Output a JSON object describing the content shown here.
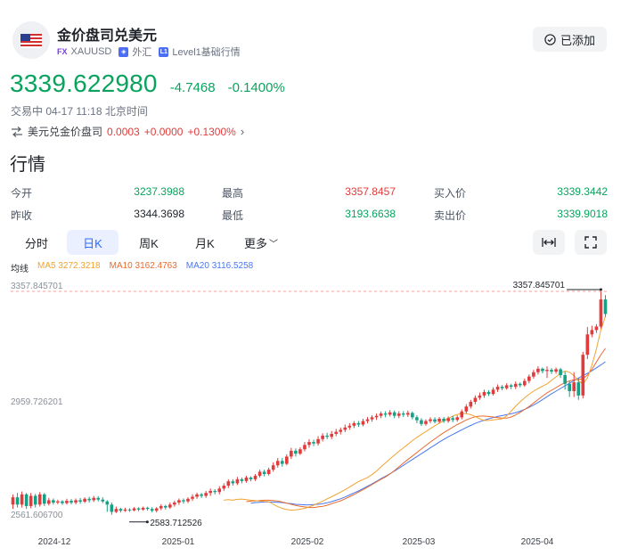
{
  "header": {
    "title": "金价盘司兑美元",
    "symbol_tag": "FX",
    "symbol": "XAUUSD",
    "market": "外汇",
    "level_tag": "L1",
    "level": "Level1基础行情",
    "added_label": "已添加"
  },
  "price": {
    "last": "3339.622980",
    "change": "-4.7468",
    "change_pct": "-0.1400%"
  },
  "status": "交易中 04-17 11:18 北京时间",
  "inverse": {
    "label": "美元兑金价盘司",
    "value": "0.0003",
    "change": "+0.0000",
    "change_pct": "+0.1300%"
  },
  "section_title": "行情",
  "quote": [
    [
      {
        "label": "今开",
        "value": "3237.3988",
        "color": "green"
      },
      {
        "label": "最高",
        "value": "3357.8457",
        "color": "red"
      },
      {
        "label": "买入价",
        "value": "3339.3442",
        "color": "green"
      }
    ],
    [
      {
        "label": "昨收",
        "value": "3344.3698",
        "color": "plain"
      },
      {
        "label": "最低",
        "value": "3193.6638",
        "color": "green"
      },
      {
        "label": "卖出价",
        "value": "3339.9018",
        "color": "green"
      }
    ]
  ],
  "tabs": [
    "分时",
    "日K",
    "周K",
    "月K",
    "更多"
  ],
  "active_tab": "日K",
  "ma_legend": {
    "label": "均线",
    "ma5": "MA5 3272.3218",
    "ma10": "MA10 3162.4763",
    "ma20": "MA20 3116.5258"
  },
  "colors": {
    "up": "#e23b3b",
    "down": "#16a085",
    "ma5": "#f2a331",
    "ma10": "#ea6a2e",
    "ma20": "#4a78f0",
    "price_green": "#0aa35e"
  },
  "chart_data": {
    "type": "candlestick",
    "y_ticks": [
      "3357.845701",
      "2959.726201",
      "2561.606700"
    ],
    "ylim": [
      2561.6067,
      3357.845701
    ],
    "high_label": "3357.845701",
    "low_label": "2583.712526",
    "x_ticks": [
      "2024-12",
      "2025-01",
      "2025-02",
      "2025-03",
      "2025-04"
    ],
    "candles": [
      [
        2625,
        2650,
        2610,
        2660
      ],
      [
        2650,
        2625,
        2615,
        2665
      ],
      [
        2625,
        2660,
        2615,
        2670
      ],
      [
        2660,
        2620,
        2610,
        2665
      ],
      [
        2620,
        2655,
        2612,
        2665
      ],
      [
        2655,
        2625,
        2615,
        2662
      ],
      [
        2625,
        2660,
        2618,
        2668
      ],
      [
        2660,
        2628,
        2620,
        2665
      ],
      [
        2628,
        2640,
        2622,
        2648
      ],
      [
        2640,
        2632,
        2625,
        2646
      ],
      [
        2632,
        2636,
        2626,
        2642
      ],
      [
        2636,
        2630,
        2624,
        2640
      ],
      [
        2630,
        2638,
        2625,
        2645
      ],
      [
        2638,
        2632,
        2626,
        2644
      ],
      [
        2632,
        2640,
        2626,
        2646
      ],
      [
        2640,
        2635,
        2628,
        2648
      ],
      [
        2635,
        2645,
        2630,
        2650
      ],
      [
        2645,
        2640,
        2632,
        2652
      ],
      [
        2640,
        2648,
        2634,
        2655
      ],
      [
        2648,
        2642,
        2636,
        2654
      ],
      [
        2642,
        2636,
        2630,
        2650
      ],
      [
        2636,
        2625,
        2600,
        2640
      ],
      [
        2625,
        2600,
        2590,
        2632
      ],
      [
        2600,
        2610,
        2596,
        2618
      ],
      [
        2610,
        2604,
        2598,
        2614
      ],
      [
        2604,
        2608,
        2600,
        2614
      ],
      [
        2608,
        2605,
        2600,
        2612
      ],
      [
        2605,
        2612,
        2602,
        2616
      ],
      [
        2612,
        2608,
        2602,
        2616
      ],
      [
        2608,
        2614,
        2604,
        2618
      ],
      [
        2614,
        2610,
        2604,
        2618
      ],
      [
        2610,
        2604,
        2598,
        2616
      ],
      [
        2604,
        2612,
        2598,
        2616
      ],
      [
        2612,
        2620,
        2606,
        2626
      ],
      [
        2620,
        2615,
        2608,
        2624
      ],
      [
        2615,
        2625,
        2610,
        2632
      ],
      [
        2625,
        2632,
        2618,
        2638
      ],
      [
        2632,
        2640,
        2624,
        2646
      ],
      [
        2640,
        2636,
        2628,
        2646
      ],
      [
        2636,
        2645,
        2630,
        2650
      ],
      [
        2645,
        2652,
        2638,
        2660
      ],
      [
        2652,
        2660,
        2645,
        2666
      ],
      [
        2660,
        2655,
        2648,
        2665
      ],
      [
        2655,
        2665,
        2648,
        2672
      ],
      [
        2665,
        2672,
        2655,
        2680
      ],
      [
        2672,
        2668,
        2660,
        2678
      ],
      [
        2668,
        2680,
        2660,
        2688
      ],
      [
        2680,
        2690,
        2672,
        2698
      ],
      [
        2690,
        2705,
        2682,
        2712
      ],
      [
        2705,
        2698,
        2690,
        2712
      ],
      [
        2698,
        2712,
        2692,
        2720
      ],
      [
        2712,
        2706,
        2698,
        2718
      ],
      [
        2706,
        2718,
        2700,
        2724
      ],
      [
        2718,
        2712,
        2705,
        2722
      ],
      [
        2712,
        2724,
        2706,
        2730
      ],
      [
        2724,
        2738,
        2718,
        2745
      ],
      [
        2738,
        2730,
        2722,
        2745
      ],
      [
        2730,
        2745,
        2725,
        2752
      ],
      [
        2745,
        2760,
        2738,
        2770
      ],
      [
        2760,
        2775,
        2752,
        2785
      ],
      [
        2775,
        2765,
        2755,
        2785
      ],
      [
        2765,
        2790,
        2760,
        2798
      ],
      [
        2790,
        2810,
        2782,
        2820
      ],
      [
        2810,
        2800,
        2790,
        2818
      ],
      [
        2800,
        2815,
        2795,
        2822
      ],
      [
        2815,
        2830,
        2808,
        2840
      ],
      [
        2830,
        2840,
        2820,
        2850
      ],
      [
        2840,
        2835,
        2826,
        2848
      ],
      [
        2835,
        2850,
        2828,
        2860
      ],
      [
        2850,
        2862,
        2842,
        2870
      ],
      [
        2862,
        2858,
        2850,
        2872
      ],
      [
        2858,
        2868,
        2850,
        2878
      ],
      [
        2868,
        2875,
        2860,
        2885
      ],
      [
        2875,
        2882,
        2866,
        2890
      ],
      [
        2882,
        2890,
        2874,
        2900
      ],
      [
        2890,
        2896,
        2882,
        2905
      ],
      [
        2896,
        2905,
        2888,
        2912
      ],
      [
        2905,
        2900,
        2892,
        2912
      ],
      [
        2900,
        2912,
        2894,
        2920
      ],
      [
        2912,
        2918,
        2904,
        2926
      ],
      [
        2918,
        2925,
        2910,
        2932
      ],
      [
        2925,
        2930,
        2916,
        2938
      ],
      [
        2930,
        2938,
        2922,
        2945
      ],
      [
        2938,
        2934,
        2925,
        2946
      ],
      [
        2934,
        2942,
        2928,
        2950
      ],
      [
        2942,
        2930,
        2922,
        2948
      ],
      [
        2930,
        2938,
        2922,
        2946
      ],
      [
        2938,
        2934,
        2926,
        2946
      ],
      [
        2934,
        2940,
        2926,
        2948
      ],
      [
        2940,
        2925,
        2918,
        2945
      ],
      [
        2925,
        2915,
        2905,
        2932
      ],
      [
        2915,
        2902,
        2895,
        2922
      ],
      [
        2902,
        2912,
        2896,
        2918
      ],
      [
        2912,
        2918,
        2905,
        2925
      ],
      [
        2918,
        2910,
        2904,
        2925
      ],
      [
        2910,
        2920,
        2904,
        2926
      ],
      [
        2920,
        2912,
        2906,
        2926
      ],
      [
        2912,
        2922,
        2906,
        2928
      ],
      [
        2922,
        2916,
        2908,
        2930
      ],
      [
        2916,
        2925,
        2910,
        2932
      ],
      [
        2925,
        2945,
        2918,
        2952
      ],
      [
        2945,
        2962,
        2938,
        2970
      ],
      [
        2962,
        2978,
        2955,
        2985
      ],
      [
        2978,
        2992,
        2970,
        3000
      ],
      [
        2992,
        3000,
        2985,
        3010
      ],
      [
        3000,
        3012,
        2992,
        3020
      ],
      [
        3012,
        3005,
        2998,
        3018
      ],
      [
        3005,
        3020,
        3000,
        3028
      ],
      [
        3020,
        3030,
        3012,
        3038
      ],
      [
        3030,
        3025,
        3018,
        3036
      ],
      [
        3025,
        3035,
        3020,
        3042
      ],
      [
        3035,
        3030,
        3022,
        3040
      ],
      [
        3030,
        3040,
        3022,
        3048
      ],
      [
        3040,
        3035,
        3028,
        3045
      ],
      [
        3035,
        3050,
        3030,
        3058
      ],
      [
        3050,
        3065,
        3042,
        3072
      ],
      [
        3065,
        3080,
        3058,
        3088
      ],
      [
        3080,
        3092,
        3072,
        3100
      ],
      [
        3092,
        3084,
        3076,
        3096
      ],
      [
        3084,
        3088,
        3060,
        3100
      ],
      [
        3088,
        3082,
        3074,
        3094
      ],
      [
        3082,
        3090,
        3075,
        3096
      ],
      [
        3090,
        3070,
        3060,
        3095
      ],
      [
        3070,
        3040,
        3020,
        3082
      ],
      [
        3040,
        3015,
        2995,
        3050
      ],
      [
        3015,
        3045,
        2995,
        3080
      ],
      [
        3045,
        3000,
        2985,
        3060
      ],
      [
        3000,
        3140,
        2990,
        3150
      ],
      [
        3140,
        3210,
        3125,
        3235
      ],
      [
        3210,
        3225,
        3200,
        3240
      ],
      [
        3225,
        3237,
        3215,
        3245
      ],
      [
        3237,
        3330,
        3230,
        3357
      ],
      [
        3330,
        3280,
        3270,
        3345
      ]
    ],
    "ma5": [
      2640,
      2642,
      2640,
      2643,
      2644,
      2642,
      2640,
      2639,
      2637,
      2636,
      2635,
      2626,
      2618,
      2612,
      2608,
      2606,
      2607,
      2609,
      2612,
      2617,
      2623,
      2630,
      2637,
      2645,
      2652,
      2660,
      2668,
      2676,
      2685,
      2695,
      2704,
      2711,
      2718,
      2728,
      2740,
      2755,
      2768,
      2782,
      2795,
      2808,
      2820,
      2832,
      2845,
      2856,
      2866,
      2876,
      2886,
      2896,
      2905,
      2913,
      2921,
      2929,
      2935,
      2938,
      2938,
      2934,
      2928,
      2920,
      2914,
      2914,
      2916,
      2918,
      2920,
      2930,
      2946,
      2963,
      2978,
      2992,
      3004,
      3015,
      3024,
      3032,
      3040,
      3052,
      3064,
      3076,
      3084,
      3080,
      3068,
      3050,
      3040,
      3060,
      3105,
      3160,
      3225,
      3272
    ],
    "ma10": [
      2635,
      2637,
      2638,
      2639,
      2640,
      2640,
      2639,
      2637,
      2634,
      2630,
      2626,
      2622,
      2619,
      2617,
      2615,
      2615,
      2617,
      2619,
      2623,
      2628,
      2633,
      2638,
      2645,
      2652,
      2660,
      2668,
      2676,
      2685,
      2694,
      2703,
      2712,
      2720,
      2730,
      2742,
      2755,
      2768,
      2780,
      2792,
      2804,
      2816,
      2828,
      2840,
      2851,
      2862,
      2872,
      2882,
      2891,
      2900,
      2908,
      2916,
      2922,
      2927,
      2929,
      2929,
      2928,
      2926,
      2924,
      2922,
      2922,
      2926,
      2933,
      2942,
      2952,
      2962,
      2974,
      2986,
      2998,
      3009,
      3018,
      3027,
      3036,
      3044,
      3050,
      3054,
      3055,
      3058,
      3070,
      3090,
      3115,
      3140,
      3162
    ],
    "ma20": [
      2630,
      2632,
      2633,
      2634,
      2634,
      2634,
      2633,
      2632,
      2630,
      2628,
      2626,
      2625,
      2624,
      2624,
      2625,
      2626,
      2628,
      2631,
      2635,
      2640,
      2645,
      2651,
      2658,
      2665,
      2672,
      2680,
      2688,
      2696,
      2705,
      2714,
      2722,
      2731,
      2740,
      2750,
      2760,
      2770,
      2780,
      2790,
      2800,
      2810,
      2820,
      2830,
      2840,
      2849,
      2858,
      2866,
      2874,
      2882,
      2890,
      2897,
      2904,
      2910,
      2915,
      2920,
      2924,
      2928,
      2931,
      2934,
      2937,
      2941,
      2946,
      2952,
      2959,
      2967,
      2976,
      2986,
      2996,
      3006,
      3015,
      3024,
      3033,
      3042,
      3051,
      3060,
      3068,
      3076,
      3085,
      3095,
      3105,
      3116
    ]
  }
}
